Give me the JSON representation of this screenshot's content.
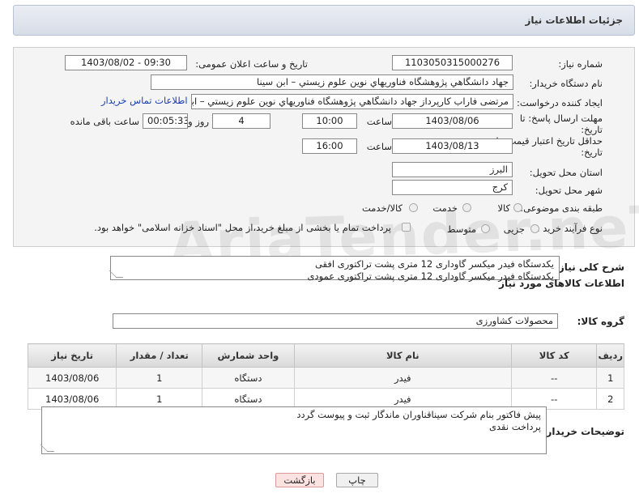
{
  "header": {
    "title": "جزئیات اطلاعات نیاز"
  },
  "form": {
    "need_number_label": "شماره نیاز:",
    "need_number": "1103050315000276",
    "announce_label": "تاریخ و ساعت اعلان عمومی:",
    "announce_value": "1403/08/02 - 09:30",
    "buyer_label": "نام دستگاه خریدار:",
    "buyer_value": "جهاد دانشگاهي پژوهشگاه فناوريهاي نوين علوم زيستي – ابن سينا",
    "requester_label": "ایجاد کننده درخواست:",
    "requester_value": "مرتضی فاراب کارپرداز جهاد دانشگاهي پژوهشگاه فناوريهاي نوين علوم زيستي – ابن سينا",
    "contact_link": "اطلاعات تماس خریدار",
    "deadline_label_1": "مهلت ارسال پاسخ: تا",
    "deadline_label_2": "تاریخ:",
    "deadline_date": "1403/08/06",
    "time_label": "ساعت",
    "deadline_time": "10:00",
    "days_value": "4",
    "days_label": "روز و",
    "remaining_time": "00:05:33",
    "remaining_label": "ساعت باقی مانده",
    "validity_label_1": "حداقل تاریخ اعتبار قیمت: تا",
    "validity_label_2": "تاریخ:",
    "validity_date": "1403/08/13",
    "validity_time": "16:00",
    "province_label": "استان محل تحویل:",
    "province_value": "البرز",
    "city_label": "شهر محل تحویل:",
    "city_value": "کرج",
    "category_label": "طبقه بندی موضوعی:",
    "category_options": [
      "کالا",
      "خدمت",
      "کالا/خدمت"
    ],
    "process_label": "نوع فرآیند خرید :",
    "process_options": [
      "جزیی",
      "متوسط"
    ],
    "payment_note": "پرداخت تمام یا بخشی از مبلغ خرید،از محل \"اسناد خزانه اسلامی\" خواهد بود."
  },
  "description": {
    "label": "شرح کلی نیاز:",
    "line1": "یکدستگاه فیدر میکسر گاوداری 12 متری پشت تراکتوری افقی",
    "line2": "یکدستگاه فیدر میکسر گاوداری 12 متری پشت تراکتوری عمودی"
  },
  "goods": {
    "section_title": "اطلاعات کالاهای مورد نیاز",
    "group_label": "گروه کالا:",
    "group_value": "محصولات کشاورزی",
    "columns": [
      "ردیف",
      "کد کالا",
      "نام کالا",
      "واحد شمارش",
      "تعداد / مقدار",
      "تاریخ نیاز"
    ],
    "rows": [
      {
        "index": "1",
        "code": "--",
        "name": "فیدر",
        "unit": "دستگاه",
        "qty": "1",
        "date": "1403/08/06"
      },
      {
        "index": "2",
        "code": "--",
        "name": "فیدر",
        "unit": "دستگاه",
        "qty": "1",
        "date": "1403/08/06"
      }
    ]
  },
  "buyer_notes": {
    "label": "توضیحات خریدار:",
    "line1": "پیش فاکتور بنام شرکت سیناقناوران ماندگار ثبت و پیوست گردد",
    "line2": "پرداخت نقدی"
  },
  "buttons": {
    "print": "چاپ",
    "back": "بازگشت"
  },
  "watermark": "AriaTender.neT"
}
